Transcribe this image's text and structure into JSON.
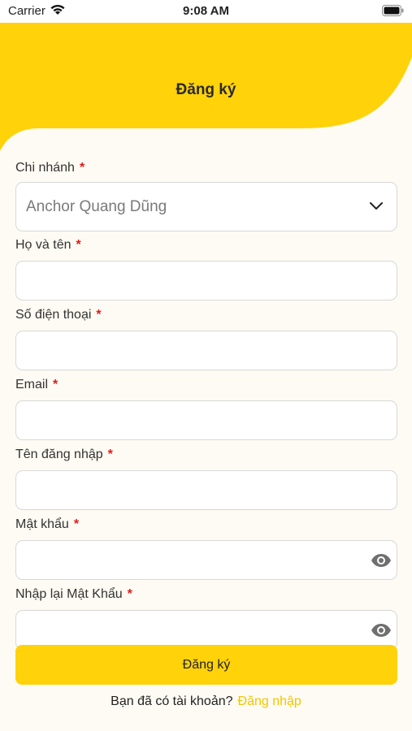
{
  "status_bar": {
    "carrier": "Carrier",
    "time": "9:08 AM"
  },
  "header": {
    "title": "Đăng ký"
  },
  "form": {
    "branch": {
      "label": "Chi nhánh",
      "required": "*",
      "value": "Anchor Quang Dũng"
    },
    "full_name": {
      "label": "Họ và tên",
      "required": "*",
      "value": ""
    },
    "phone": {
      "label": "Số điện thoại",
      "required": "*",
      "value": ""
    },
    "email": {
      "label": "Email",
      "required": "*",
      "value": ""
    },
    "username": {
      "label": "Tên đăng nhập",
      "required": "*",
      "value": ""
    },
    "password": {
      "label": "Mật khẩu",
      "required": "*",
      "value": ""
    },
    "confirm_password": {
      "label": "Nhập lại Mật Khẩu",
      "required": "*",
      "value": ""
    },
    "submit_label": "Đăng ký"
  },
  "footer": {
    "prompt": "Bạn đã có tài khoản?",
    "login_link": "Đăng nhập"
  },
  "colors": {
    "accent": "#FFD20A",
    "background": "#FDFBF3",
    "required": "#E11B1B",
    "link": "#F5C400"
  },
  "icons": [
    "wifi-icon",
    "battery-icon",
    "chevron-down-icon",
    "eye-icon"
  ]
}
